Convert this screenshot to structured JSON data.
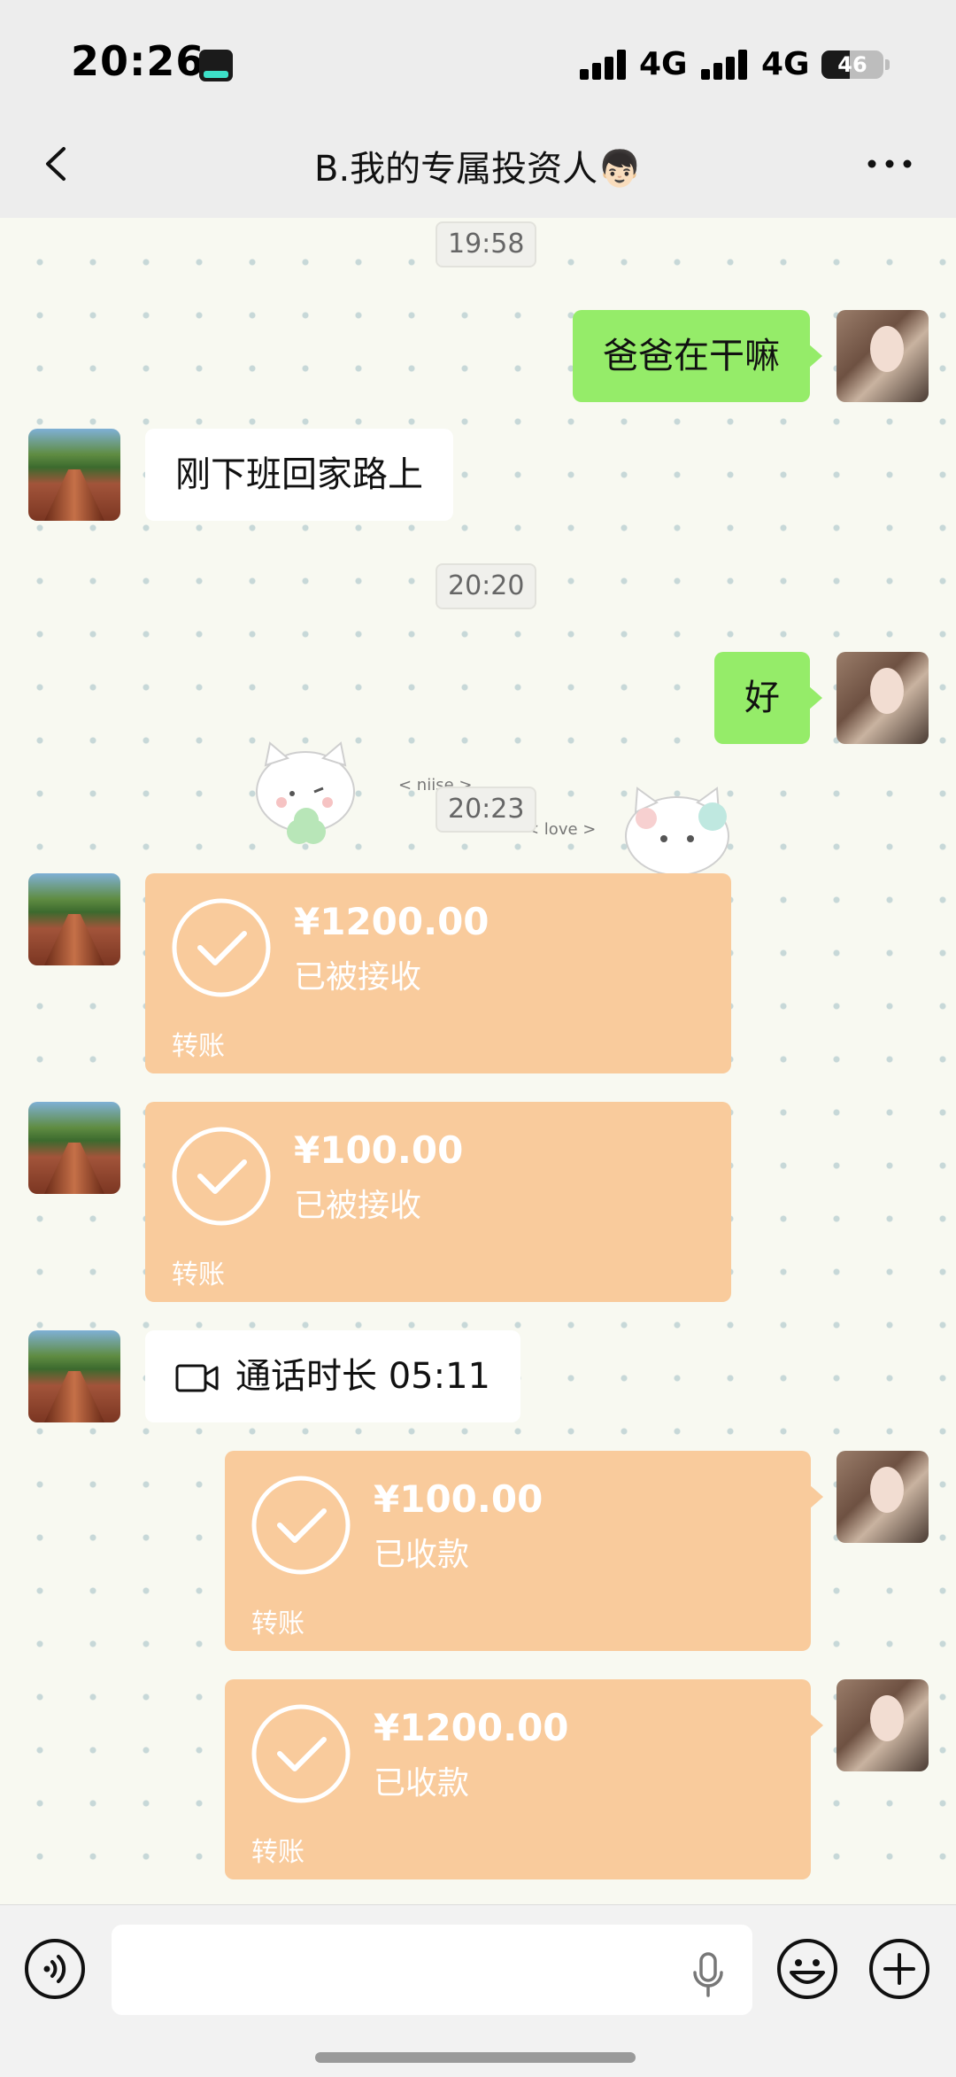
{
  "status_bar": {
    "time": "20:26",
    "network_1": "4G",
    "network_2": "4G",
    "battery": "46",
    "battery_level_percent": 46
  },
  "nav": {
    "title": "B.我的专属投资人👦🏻"
  },
  "chat": {
    "timestamps": [
      "19:58",
      "20:20",
      "20:23"
    ],
    "messages": [
      {
        "side": "right",
        "type": "text",
        "text": "爸爸在干嘛"
      },
      {
        "side": "left",
        "type": "text",
        "text": "刚下班回家路上"
      },
      {
        "side": "right",
        "type": "text",
        "text": "好"
      },
      {
        "side": "left",
        "type": "transfer",
        "amount": "¥1200.00",
        "status": "已被接收",
        "label": "转账"
      },
      {
        "side": "left",
        "type": "transfer",
        "amount": "¥100.00",
        "status": "已被接收",
        "label": "转账"
      },
      {
        "side": "left",
        "type": "call",
        "text": "通话时长 05:11"
      },
      {
        "side": "right",
        "type": "transfer",
        "amount": "¥100.00",
        "status": "已收款",
        "label": "转账"
      },
      {
        "side": "right",
        "type": "transfer",
        "amount": "¥1200.00",
        "status": "已收款",
        "label": "转账"
      }
    ],
    "sticker_labels": [
      "< niise >",
      "< love >"
    ]
  },
  "input": {
    "voice_icon": "voice-icon",
    "mic_icon": "mic-icon",
    "emoji_icon": "emoji-icon",
    "plus_icon": "plus-icon"
  },
  "colors": {
    "self_bubble": "#95ec69",
    "transfer_bubble": "#f9cb9c",
    "other_bubble": "#ffffff"
  }
}
